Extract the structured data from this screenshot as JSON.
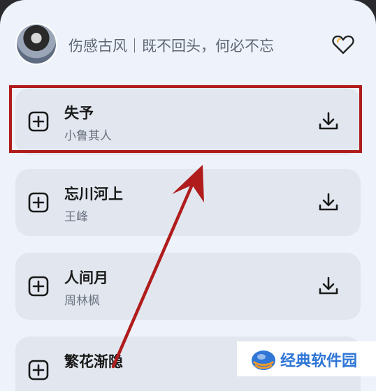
{
  "header": {
    "playlist_title": "伤感古风｜既不回头，何必不忘"
  },
  "songs": [
    {
      "title": "失予",
      "artist": "小鲁其人",
      "highlighted": true
    },
    {
      "title": "忘川河上",
      "artist": "王峰",
      "highlighted": false
    },
    {
      "title": "人间月",
      "artist": "周林枫",
      "highlighted": false
    },
    {
      "title": "繁花渐隐",
      "artist": "",
      "highlighted": false
    }
  ],
  "icons": {
    "add": "add-square-icon",
    "download": "download-icon",
    "favorite": "heart-icon"
  },
  "colors": {
    "background": "#eef3fb",
    "card": "#e2e7ef",
    "highlight": "#b01c1c",
    "watermark_text": "#2f76d6"
  },
  "watermark": {
    "text": "经典软件园"
  }
}
